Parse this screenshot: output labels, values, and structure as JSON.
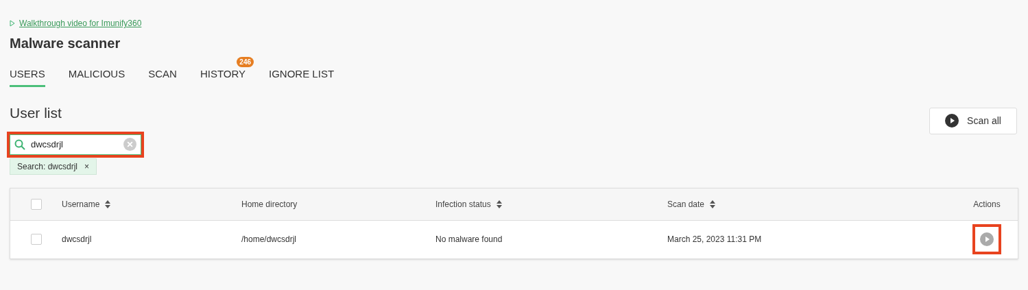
{
  "walkthrough_link": "Walkthrough video for Imunify360",
  "title": "Malware scanner",
  "tabs": [
    {
      "label": "USERS",
      "selected": true
    },
    {
      "label": "MALICIOUS",
      "selected": false
    },
    {
      "label": "SCAN",
      "selected": false
    },
    {
      "label": "HISTORY",
      "selected": false,
      "badge": "246"
    },
    {
      "label": "IGNORE LIST",
      "selected": false
    }
  ],
  "section_title": "User list",
  "scan_all_button": "Scan all",
  "search": {
    "value": "dwcsdrjl",
    "highlighted": true
  },
  "filter_chips": [
    {
      "label": "Search: dwcsdrjl",
      "remove": "×"
    }
  ],
  "table": {
    "columns": [
      {
        "label": "Username",
        "sortable": true
      },
      {
        "label": "Home directory",
        "sortable": false
      },
      {
        "label": "Infection status",
        "sortable": true
      },
      {
        "label": "Scan date",
        "sortable": true
      },
      {
        "label": "Actions",
        "sortable": false
      }
    ],
    "header_checked": false,
    "rows": [
      {
        "checked": false,
        "cells": [
          "dwcsdrjl",
          "/home/dwcsdrjl",
          "No malware found",
          "March 25, 2023 11:31 PM"
        ],
        "action_highlighted": true
      }
    ]
  }
}
